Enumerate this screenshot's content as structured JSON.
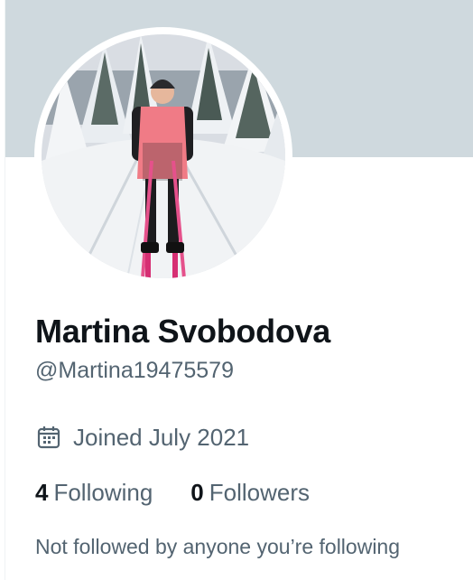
{
  "profile": {
    "display_name": "Martina Svobodova",
    "handle": "@Martina19475579",
    "joined": "Joined July 2021",
    "following_count": "4",
    "following_label": "Following",
    "followers_count": "0",
    "followers_label": "Followers",
    "mutual_note": "Not followed by anyone you’re following"
  },
  "icons": {
    "joined": "calendar-icon"
  },
  "colors": {
    "banner": "#cfd9de",
    "text_primary": "#0f1419",
    "text_secondary": "#536471",
    "avatar_vest": "#f07b86"
  }
}
